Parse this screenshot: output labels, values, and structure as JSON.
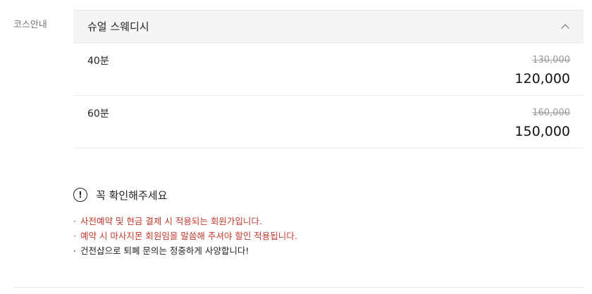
{
  "section_label": "코스안내",
  "course": {
    "title": "슈얼 스웨디시",
    "options": [
      {
        "duration": "40분",
        "original_price": "130,000",
        "sale_price": "120,000"
      },
      {
        "duration": "60분",
        "original_price": "160,000",
        "sale_price": "150,000"
      }
    ]
  },
  "notice": {
    "icon": "exclamation-circle-icon",
    "title": "꼭 확인해주세요",
    "bullet": "·",
    "items": [
      {
        "text": "사전예약 및 현금 결제 시 적용되는 회원가입니다.",
        "color": "#c0392b"
      },
      {
        "text": "예약 시 마사지몬 회원임을 말씀해 주셔야 할인 적용됩니다.",
        "color": "#c0392b"
      },
      {
        "text": "건전샵으로 퇴폐 문의는 정중하게 사양합니다!",
        "color": "#222222"
      }
    ]
  }
}
